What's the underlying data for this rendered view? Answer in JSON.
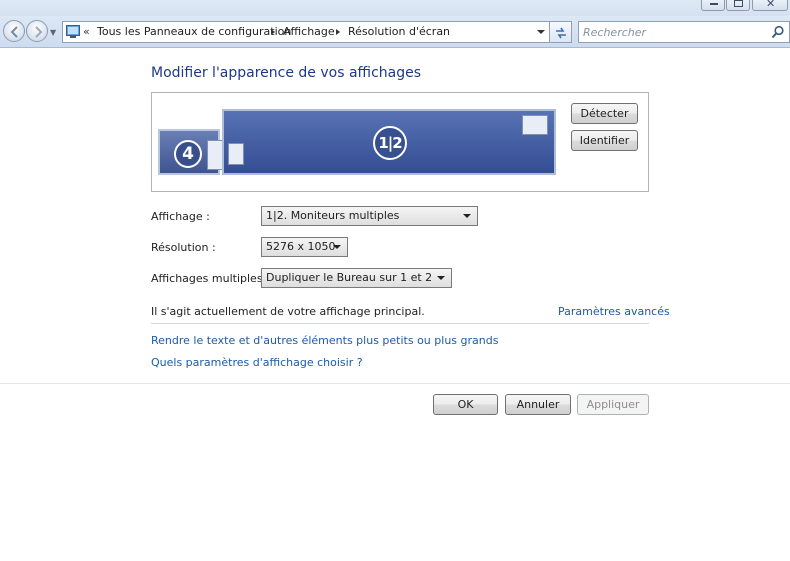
{
  "window": {
    "controls": [
      "minimize-icon",
      "maximize-icon",
      "close-icon"
    ]
  },
  "navigation": {
    "back_icon": "back-arrow-icon",
    "forward_icon": "forward-arrow-icon",
    "address_overflow": "«",
    "breadcrumbs": [
      "Tous les Panneaux de configuration",
      "Affichage",
      "Résolution d'écran"
    ],
    "search_placeholder": "Rechercher"
  },
  "main": {
    "heading": "Modifier l'apparence de vos affichages",
    "monitors": [
      {
        "label": "4"
      },
      {
        "label": "1|2"
      }
    ],
    "detect_label": "Détecter",
    "identify_label": "Identifier",
    "display_label": "Affichage :",
    "display_value": "1|2. Moniteurs multiples",
    "resolution_label": "Résolution :",
    "resolution_value": "5276 x 1050",
    "multiple_label": "Affichages multiples :",
    "multiple_value": "Dupliquer le Bureau sur 1 et 2",
    "primary_text": "Il s'agit actuellement de votre affichage principal.",
    "advanced_link": "Paramètres avancés",
    "text_size_link": "Rendre le texte et d'autres éléments plus petits ou plus grands",
    "which_settings_link": "Quels paramètres d'affichage choisir ?"
  },
  "footer": {
    "ok_label": "OK",
    "cancel_label": "Annuler",
    "apply_label": "Appliquer"
  },
  "colors": {
    "heading": "#1e3a87",
    "link": "#1b5ba8",
    "monitor_fill": "#3f5591"
  }
}
